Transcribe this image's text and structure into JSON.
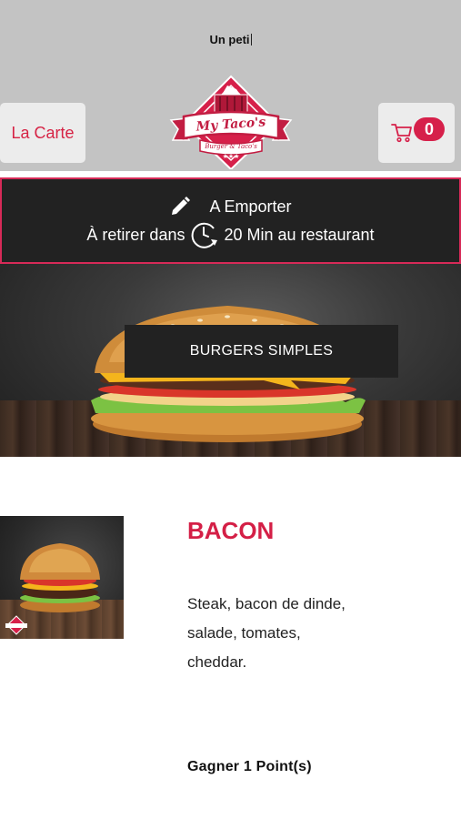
{
  "header": {
    "marquee_text": "Un peti",
    "menu_button_label": "La Carte",
    "cart_count": "0",
    "logo": {
      "name_text": "My Taco's",
      "tagline": "Burger & Taco's",
      "stars": "★★★"
    },
    "background_color": "#c3c3c3",
    "accent_color": "#d6204a"
  },
  "order_bar": {
    "mode_label": "A Emporter",
    "pickup_prefix": "À retirer dans",
    "pickup_suffix": "20 Min au restaurant",
    "border_color": "#d72a58"
  },
  "category": {
    "label": "BURGERS SIMPLES"
  },
  "product": {
    "name": "BACON",
    "description": "Steak, bacon de dinde, salade, tomates, cheddar.",
    "points": "Gagner 1 Point(s)",
    "title_color": "#d41f46"
  },
  "icons": [
    "cart-icon",
    "pencil-icon",
    "clock-icon"
  ]
}
